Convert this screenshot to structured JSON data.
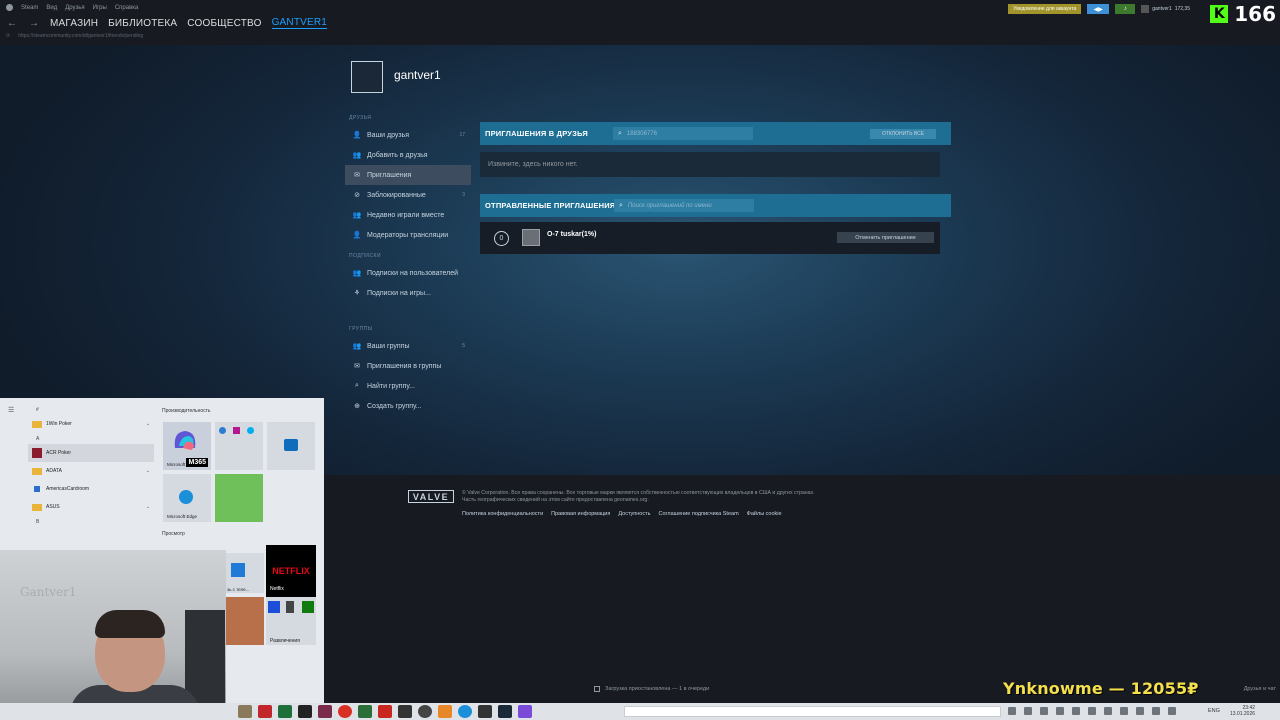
{
  "steam_menu": [
    "Steam",
    "Вид",
    "Друзья",
    "Игры",
    "Справка"
  ],
  "nav": {
    "back": "←",
    "forward": "→",
    "tabs": [
      "МАГАЗИН",
      "БИБЛИОТЕКА",
      "СООБЩЕСТВО",
      "GANTVER1"
    ],
    "active_tab": "GANTVER1",
    "url": "https://steamcommunity.com/id/gantver1/friends/pending"
  },
  "top_right": {
    "notification_button": "Уведомление для аккаунта",
    "username": "gantver1",
    "wallet": "172,35"
  },
  "kick_overlay": {
    "logo": "K",
    "viewer_count": "166"
  },
  "profile": {
    "name": "gantver1"
  },
  "sidebar": {
    "section_friends": "ДРУЗЬЯ",
    "friends_items": [
      {
        "label": "Ваши друзья",
        "count": "17",
        "icon": "person-icon"
      },
      {
        "label": "Добавить в друзья",
        "count": "",
        "icon": "add-person-icon"
      },
      {
        "label": "Приглашения",
        "count": "",
        "icon": "mail-icon"
      },
      {
        "label": "Заблокированные",
        "count": "3",
        "icon": "block-icon"
      },
      {
        "label": "Недавно играли вместе",
        "count": "",
        "icon": "people-icon"
      },
      {
        "label": "Модераторы трансляции",
        "count": "",
        "icon": "person-icon"
      }
    ],
    "section_subs": "ПОДПИСКИ",
    "subs_items": [
      {
        "label": "Подписки на пользователей",
        "icon": "people-icon"
      },
      {
        "label": "Подписки на игры...",
        "icon": "gamepad-icon"
      }
    ],
    "section_groups": "ГРУППЫ",
    "groups_items": [
      {
        "label": "Ваши группы",
        "count": "5",
        "icon": "people-icon"
      },
      {
        "label": "Приглашения в группы",
        "count": "",
        "icon": "mail-icon"
      },
      {
        "label": "Найти группу...",
        "count": "",
        "icon": "search-icon"
      },
      {
        "label": "Создать группу...",
        "count": "",
        "icon": "plus-icon"
      }
    ]
  },
  "incoming": {
    "title": "ПРИГЛАШЕНИЯ В ДРУЗЬЯ",
    "search_value": "188306776",
    "reject_all": "ОТКЛОНИТЬ ВСЕ",
    "empty_text": "Извините, здесь никого нет."
  },
  "outgoing": {
    "title": "ОТПРАВЛЕННЫЕ ПРИГЛАШЕНИЯ",
    "search_placeholder": "Поиск приглашений по имени",
    "rows": [
      {
        "index": "0",
        "name": "O-7 tuskar(1%)",
        "cancel_label": "Отменить приглашение"
      }
    ]
  },
  "footer": {
    "valve_logo": "VALVE",
    "copyright": "© Valve Corporation. Все права сохранены. Все торговые марки являются собственностью соответствующих владельцев в США и других странах.",
    "geo_note": "Часть географических сведений на этом сайте предоставлена geonames.org.",
    "links": [
      "Политика конфиденциальности",
      "Правовая информация",
      "Доступность",
      "Соглашение подписчика Steam",
      "Файлы cookie"
    ]
  },
  "start_menu": {
    "apps": [
      {
        "type": "letter",
        "label": "#"
      },
      {
        "type": "folder",
        "label": "1Win Poker"
      },
      {
        "type": "letter",
        "label": "A"
      },
      {
        "type": "app",
        "label": "ACR Poker"
      },
      {
        "type": "folder",
        "label": "ADATA"
      },
      {
        "type": "app",
        "label": "AmericasCardroom"
      },
      {
        "type": "folder",
        "label": "ASUS"
      },
      {
        "type": "letter",
        "label": "B"
      }
    ],
    "group_productivity": "Производительность",
    "group_browse": "Просмотр",
    "tile_m365_label": "Microsoft",
    "tile_m365_badge": "M365",
    "tile_edge": "Microsoft Edge",
    "tile_netflix": "NETFLIX",
    "tile_netflix_label": "Netflix",
    "tile_entertainment": "Развлечения",
    "tile_phone": "зь с теле..."
  },
  "webcam": {
    "wall_text": "Gantver1"
  },
  "status_bar": {
    "download": "Загрузка приостановлена — 1 в очереди",
    "friends_chat": "Друзья и чат"
  },
  "donation_overlay": "Ynknowme — 12055₽",
  "taskbar": {
    "language": "ENG",
    "time": "23:42",
    "date": "13.01.2026"
  }
}
